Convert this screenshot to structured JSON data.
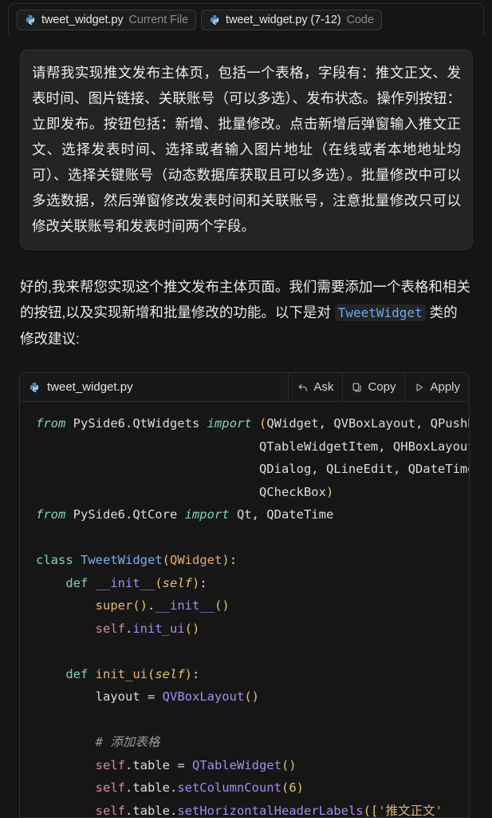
{
  "context_chips": [
    {
      "icon": "python-file-icon",
      "name": "tweet_widget.py",
      "kind": "Current File"
    },
    {
      "icon": "python-file-icon",
      "name": "tweet_widget.py (7-12)",
      "kind": "Code"
    }
  ],
  "user_message": {
    "text": "请帮我实现推文发布主体页，包括一个表格，字段有：推文正文、发表时间、图片链接、关联账号（可以多选）、发布状态。操作列按钮：立即发布。按钮包括：新增、批量修改。点击新增后弹窗输入推文正文、选择发表时间、选择或者输入图片地址（在线或者本地地址均可）、选择关键账号（动态数据库获取且可以多选）。批量修改中可以多选数据，然后弹窗修改发表时间和关联账号，注意批量修改只可以修改关联账号和发表时间两个字段。"
  },
  "assistant_message": {
    "part1": "好的,我来帮您实现这个推文发布主体页面。我们需要添加一个表格和相关的按钮,以及实现新增和批量修改的功能。以下是对 ",
    "inline_code": "TweetWidget",
    "part2": " 类的修改建议:"
  },
  "code_block": {
    "filename": "tweet_widget.py",
    "file_icon": "python-file-icon",
    "actions": [
      {
        "icon": "arrow-undo-icon",
        "label": "Ask"
      },
      {
        "icon": "copy-icon",
        "label": "Copy"
      },
      {
        "icon": "play-triangle-icon",
        "label": "Apply"
      }
    ],
    "language": "python",
    "lines": [
      [
        {
          "t": "from",
          "c": "t-kw"
        },
        {
          "t": " PySide6.QtWidgets ",
          "c": "t-plain"
        },
        {
          "t": "import",
          "c": "t-kw"
        },
        {
          "t": " ",
          "c": "t-plain"
        },
        {
          "t": "(",
          "c": "t-paren"
        },
        {
          "t": "QWidget, QVBoxLayout, QPushButton, QTableWidget,",
          "c": "t-plain"
        }
      ],
      [
        {
          "t": "                              QTableWidgetItem, QHBoxLayout, QHeaderView,",
          "c": "t-plain"
        }
      ],
      [
        {
          "t": "                              QDialog, QLineEdit, QDateTimeEdit, QComboBox,",
          "c": "t-plain"
        }
      ],
      [
        {
          "t": "                              QCheckBox",
          "c": "t-plain"
        },
        {
          "t": ")",
          "c": "t-paren"
        }
      ],
      [
        {
          "t": "from",
          "c": "t-kw"
        },
        {
          "t": " PySide6.QtCore ",
          "c": "t-plain"
        },
        {
          "t": "import",
          "c": "t-kw"
        },
        {
          "t": " Qt, QDateTime",
          "c": "t-plain"
        }
      ],
      [
        {
          "t": "",
          "c": "t-plain"
        }
      ],
      [
        {
          "t": "class",
          "c": "t-kw2"
        },
        {
          "t": " ",
          "c": "t-plain"
        },
        {
          "t": "TweetWidget",
          "c": "t-cls"
        },
        {
          "t": "(",
          "c": "t-paren"
        },
        {
          "t": "QWidget",
          "c": "t-type"
        },
        {
          "t": ")",
          "c": "t-paren"
        },
        {
          "t": ":",
          "c": "t-plain"
        }
      ],
      [
        {
          "t": "    ",
          "c": "t-plain"
        },
        {
          "t": "def",
          "c": "t-kw2"
        },
        {
          "t": " ",
          "c": "t-plain"
        },
        {
          "t": "__init__",
          "c": "t-dunder"
        },
        {
          "t": "(",
          "c": "t-paren"
        },
        {
          "t": "self",
          "c": "t-selfp"
        },
        {
          "t": ")",
          "c": "t-paren"
        },
        {
          "t": ":",
          "c": "t-plain"
        }
      ],
      [
        {
          "t": "        ",
          "c": "t-plain"
        },
        {
          "t": "super",
          "c": "t-fn"
        },
        {
          "t": "()",
          "c": "t-paren"
        },
        {
          "t": ".",
          "c": "t-plain"
        },
        {
          "t": "__init__",
          "c": "t-dunder"
        },
        {
          "t": "()",
          "c": "t-paren"
        }
      ],
      [
        {
          "t": "        ",
          "c": "t-plain"
        },
        {
          "t": "self",
          "c": "t-self"
        },
        {
          "t": ".",
          "c": "t-plain"
        },
        {
          "t": "init_ui",
          "c": "t-call"
        },
        {
          "t": "()",
          "c": "t-paren"
        }
      ],
      [
        {
          "t": "",
          "c": "t-plain"
        }
      ],
      [
        {
          "t": "    ",
          "c": "t-plain"
        },
        {
          "t": "def",
          "c": "t-kw2"
        },
        {
          "t": " ",
          "c": "t-plain"
        },
        {
          "t": "init_ui",
          "c": "t-fn"
        },
        {
          "t": "(",
          "c": "t-paren"
        },
        {
          "t": "self",
          "c": "t-selfp"
        },
        {
          "t": ")",
          "c": "t-paren"
        },
        {
          "t": ":",
          "c": "t-plain"
        }
      ],
      [
        {
          "t": "        layout ",
          "c": "t-plain"
        },
        {
          "t": "= ",
          "c": "t-plain"
        },
        {
          "t": "QVBoxLayout",
          "c": "t-call"
        },
        {
          "t": "()",
          "c": "t-paren"
        }
      ],
      [
        {
          "t": "",
          "c": "t-plain"
        }
      ],
      [
        {
          "t": "        ",
          "c": "t-plain"
        },
        {
          "t": "# 添加表格",
          "c": "t-comment"
        }
      ],
      [
        {
          "t": "        ",
          "c": "t-plain"
        },
        {
          "t": "self",
          "c": "t-self"
        },
        {
          "t": ".table ",
          "c": "t-plain"
        },
        {
          "t": "= ",
          "c": "t-plain"
        },
        {
          "t": "QTableWidget",
          "c": "t-call"
        },
        {
          "t": "()",
          "c": "t-paren"
        }
      ],
      [
        {
          "t": "        ",
          "c": "t-plain"
        },
        {
          "t": "self",
          "c": "t-self"
        },
        {
          "t": ".table.",
          "c": "t-plain"
        },
        {
          "t": "setColumnCount",
          "c": "t-call"
        },
        {
          "t": "(",
          "c": "t-paren"
        },
        {
          "t": "6",
          "c": "t-num"
        },
        {
          "t": ")",
          "c": "t-paren"
        }
      ],
      [
        {
          "t": "        ",
          "c": "t-plain"
        },
        {
          "t": "self",
          "c": "t-self"
        },
        {
          "t": ".table.",
          "c": "t-plain"
        },
        {
          "t": "setHorizontalHeaderLabels",
          "c": "t-call"
        },
        {
          "t": "([",
          "c": "t-paren"
        },
        {
          "t": "'推文正文'",
          "c": "t-str"
        }
      ]
    ]
  },
  "colors": {
    "page_background": "#151515",
    "user_bubble_background": "#242424",
    "code_background": "#161616",
    "inline_code_accent": "#6aa9f0",
    "python_icon_blue": "#5a9fd4"
  }
}
